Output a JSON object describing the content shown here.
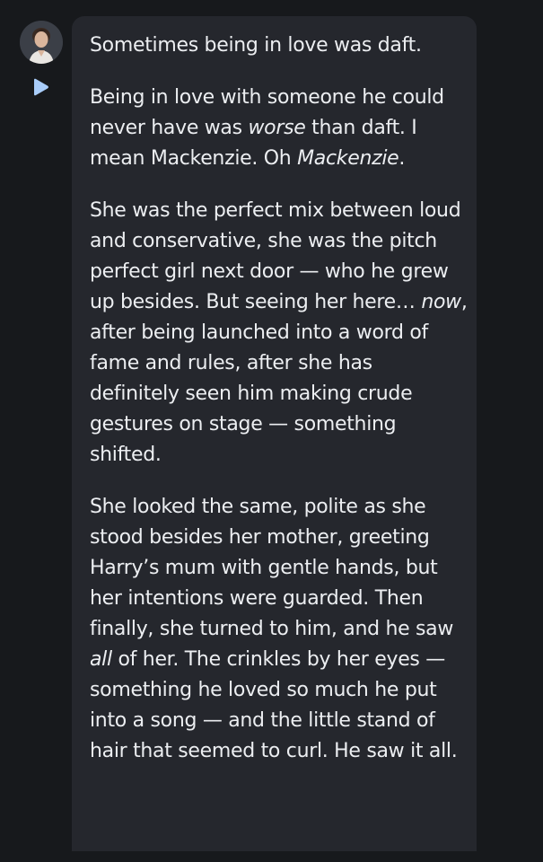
{
  "message": {
    "paragraphs": [
      [
        {
          "text": "Sometimes being in love was daft.",
          "italic": false
        }
      ],
      [
        {
          "text": "Being in love with someone he could never have was ",
          "italic": false
        },
        {
          "text": "worse",
          "italic": true
        },
        {
          "text": " than daft. I mean Mackenzie. Oh ",
          "italic": false
        },
        {
          "text": "Mackenzie",
          "italic": true
        },
        {
          "text": ".",
          "italic": false
        }
      ],
      [
        {
          "text": "She was the perfect mix between loud and conservative, she was the pitch perfect girl next door — who he grew up besides. But seeing her here… ",
          "italic": false
        },
        {
          "text": "now",
          "italic": true
        },
        {
          "text": ", after being launched into a word of fame and rules, after she has definitely seen him making crude gestures on stage — something shifted.",
          "italic": false
        }
      ],
      [
        {
          "text": "She looked the same, polite as she stood besides her mother, greeting Harry’s mum with gentle hands, but her intentions were guarded. Then finally, she turned to him, and he saw ",
          "italic": false
        },
        {
          "text": "all",
          "italic": true
        },
        {
          "text": " of her. The crinkles by her eyes — something he loved so much he put into a song — and the little stand of hair that seemed to curl. He saw it all.",
          "italic": false
        }
      ]
    ]
  },
  "icons": {
    "avatar": "user-avatar",
    "play": "play-icon"
  },
  "colors": {
    "page_background": "#17191c",
    "bubble_background": "#25272d",
    "text": "#eceef1",
    "play_icon": "#a9cdfa"
  }
}
